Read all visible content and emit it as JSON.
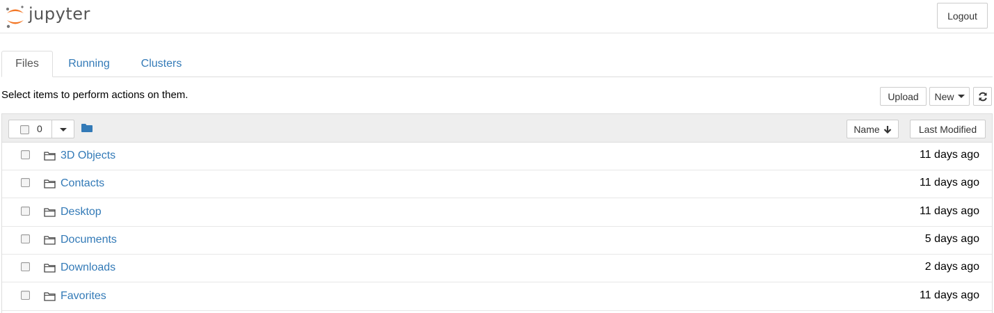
{
  "header": {
    "logo_text": "jupyter",
    "logout_label": "Logout"
  },
  "tabs": [
    {
      "label": "Files",
      "active": true
    },
    {
      "label": "Running",
      "active": false
    },
    {
      "label": "Clusters",
      "active": false
    }
  ],
  "toolbar": {
    "message": "Select items to perform actions on them.",
    "upload_label": "Upload",
    "new_label": "New",
    "refresh_icon": "refresh-icon"
  },
  "list_header": {
    "selected_count": "0",
    "sort_name_label": "Name",
    "sort_modified_label": "Last Modified"
  },
  "items": [
    {
      "name": "3D Objects",
      "modified": "11 days ago",
      "icon": "folder-icon"
    },
    {
      "name": "Contacts",
      "modified": "11 days ago",
      "icon": "folder-icon"
    },
    {
      "name": "Desktop",
      "modified": "11 days ago",
      "icon": "folder-icon"
    },
    {
      "name": "Documents",
      "modified": "5 days ago",
      "icon": "folder-icon"
    },
    {
      "name": "Downloads",
      "modified": "2 days ago",
      "icon": "folder-icon"
    },
    {
      "name": "Favorites",
      "modified": "11 days ago",
      "icon": "folder-icon"
    }
  ],
  "colors": {
    "link": "#337ab7",
    "logo_orange": "#f37726",
    "logo_grey": "#767677",
    "header_bg": "#eeeeee"
  }
}
